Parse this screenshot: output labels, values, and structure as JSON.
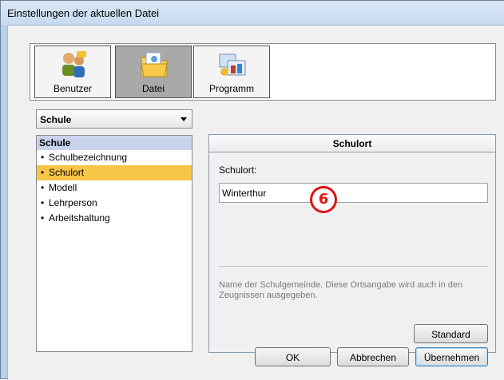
{
  "window": {
    "title": "Einstellungen der aktuellen Datei"
  },
  "toolbar": {
    "buttons": [
      {
        "label": "Benutzer",
        "icon": "users-icon",
        "active": false
      },
      {
        "label": "Datei",
        "icon": "folder-icon",
        "active": true
      },
      {
        "label": "Programm",
        "icon": "program-icon",
        "active": false
      }
    ]
  },
  "category_select": {
    "value": "Schule"
  },
  "tree": {
    "header": "Schule",
    "items": [
      {
        "label": "Schulbezeichnung",
        "selected": false
      },
      {
        "label": "Schulort",
        "selected": true
      },
      {
        "label": "Modell",
        "selected": false
      },
      {
        "label": "Lehrperson",
        "selected": false
      },
      {
        "label": "Arbeitshaltung",
        "selected": false
      }
    ]
  },
  "panel": {
    "title": "Schulort",
    "field_label": "Schulort:",
    "field_value": "Winterthur",
    "description": "Name der Schulgemeinde. Diese Ortsangabe wird auch in den Zeugnissen ausgegeben.",
    "standard_button": "Standard"
  },
  "badge": {
    "number": "6",
    "color": "#e01414"
  },
  "footer": {
    "ok_label": "OK",
    "cancel_label": "Abbrechen",
    "apply_label": "Übernehmen"
  },
  "colors": {
    "selection": "#f7c545",
    "tree_header": "#c9d3ec",
    "window_frame": "#b9d1ea"
  }
}
